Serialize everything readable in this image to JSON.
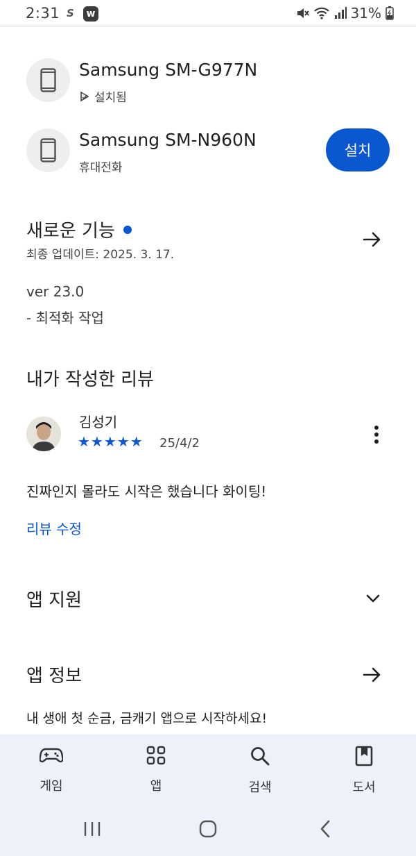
{
  "status_bar": {
    "time": "2:31",
    "s_badge": "S",
    "w_badge": "w",
    "battery": "31%"
  },
  "devices": [
    {
      "name": "Samsung SM-G977N",
      "status": "설치됨"
    },
    {
      "name": "Samsung SM-N960N",
      "status": "휴대전화",
      "install_label": "설치"
    }
  ],
  "whats_new": {
    "title": "새로운 기능",
    "last_update": "최종 업데이트: 2025. 3. 17.",
    "version": "ver 23.0",
    "note": "- 최적화 작업"
  },
  "my_review": {
    "title": "내가 작성한 리뷰",
    "reviewer": "김성기",
    "stars": "★★★★★",
    "rating": 5,
    "date": "25/4/2",
    "text": "진짜인지 몰라도 시작은 했습니다 화이팅!",
    "edit_label": "리뷰 수정"
  },
  "app_support": {
    "title": "앱 지원"
  },
  "app_info": {
    "title": "앱 정보",
    "description": "내 생애 첫 순금, 금캐기 앱으로 시작하세요!"
  },
  "bottom_nav": [
    {
      "label": "게임",
      "icon": "gamepad-icon"
    },
    {
      "label": "앱",
      "icon": "apps-grid-icon"
    },
    {
      "label": "검색",
      "icon": "search-icon"
    },
    {
      "label": "도서",
      "icon": "book-icon"
    }
  ],
  "colors": {
    "accent": "#0b57d0",
    "nav_bg": "#edf2fa"
  }
}
